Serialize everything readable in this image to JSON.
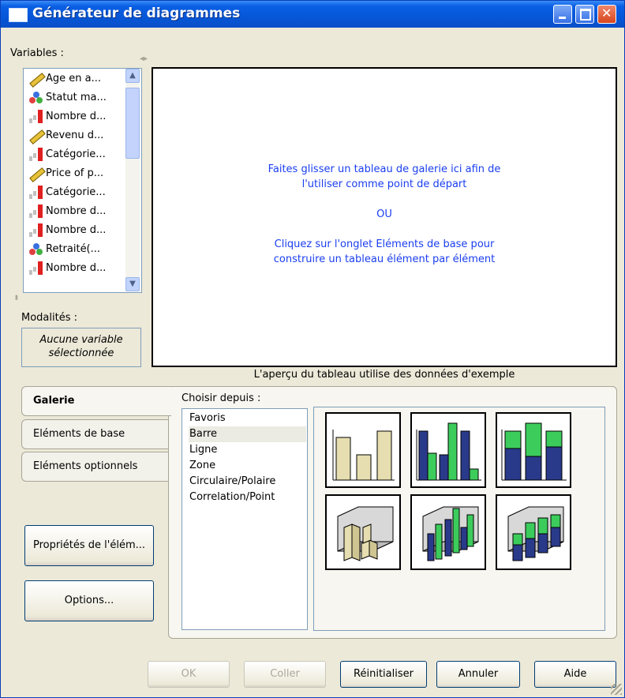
{
  "window": {
    "title": "Générateur de diagrammes"
  },
  "variables": {
    "label": "Variables :",
    "items": [
      {
        "label": "Age en a...",
        "type": "scale"
      },
      {
        "label": "Statut ma...",
        "type": "nominal"
      },
      {
        "label": "Nombre d...",
        "type": "ordinal"
      },
      {
        "label": "Revenu d...",
        "type": "scale"
      },
      {
        "label": "Catégorie...",
        "type": "ordinal"
      },
      {
        "label": "Price of p...",
        "type": "scale"
      },
      {
        "label": "Catégorie...",
        "type": "ordinal"
      },
      {
        "label": "Nombre d...",
        "type": "ordinal"
      },
      {
        "label": "Nombre d...",
        "type": "ordinal"
      },
      {
        "label": "Retraité(...",
        "type": "nominal"
      },
      {
        "label": "Nombre d...",
        "type": "ordinal"
      }
    ]
  },
  "modalites": {
    "label": "Modalités :",
    "empty": "Aucune variable sélectionnée"
  },
  "canvas": {
    "line1": "Faites glisser un tableau de galerie ici afin de",
    "line2": "l'utiliser comme point de départ",
    "or": "OU",
    "line3": "Cliquez sur l'onglet Eléments de base pour",
    "line4": "construire un tableau élément par élément",
    "caption": "L'aperçu du tableau utilise des données d'exemple"
  },
  "tabs": [
    {
      "label": "Galerie",
      "active": true
    },
    {
      "label": "Eléments de base",
      "active": false
    },
    {
      "label": "Eléments optionnels",
      "active": false
    }
  ],
  "side_buttons": {
    "properties": "Propriétés de l'élém...",
    "options": "Options..."
  },
  "gallery": {
    "choose_label": "Choisir depuis :",
    "items": [
      "Favoris",
      "Barre",
      "Ligne",
      "Zone",
      "Circulaire/Polaire",
      "Correlation/Point"
    ],
    "selected": "Barre",
    "thumbnails": [
      "simple-bar",
      "clustered-bar",
      "stacked-bar",
      "3d-simple-bar",
      "3d-clustered-bar",
      "3d-stacked-bar"
    ]
  },
  "footer": {
    "ok": "OK",
    "paste": "Coller",
    "reset": "Réinitialiser",
    "cancel": "Annuler",
    "help": "Aide"
  },
  "colors": {
    "title_bar": "#0a5fe4",
    "canvas_text": "#1a3ef0",
    "bar_beige": "#e6deb0",
    "bar_navy": "#2a3a8a",
    "bar_green": "#3ccc5c"
  }
}
